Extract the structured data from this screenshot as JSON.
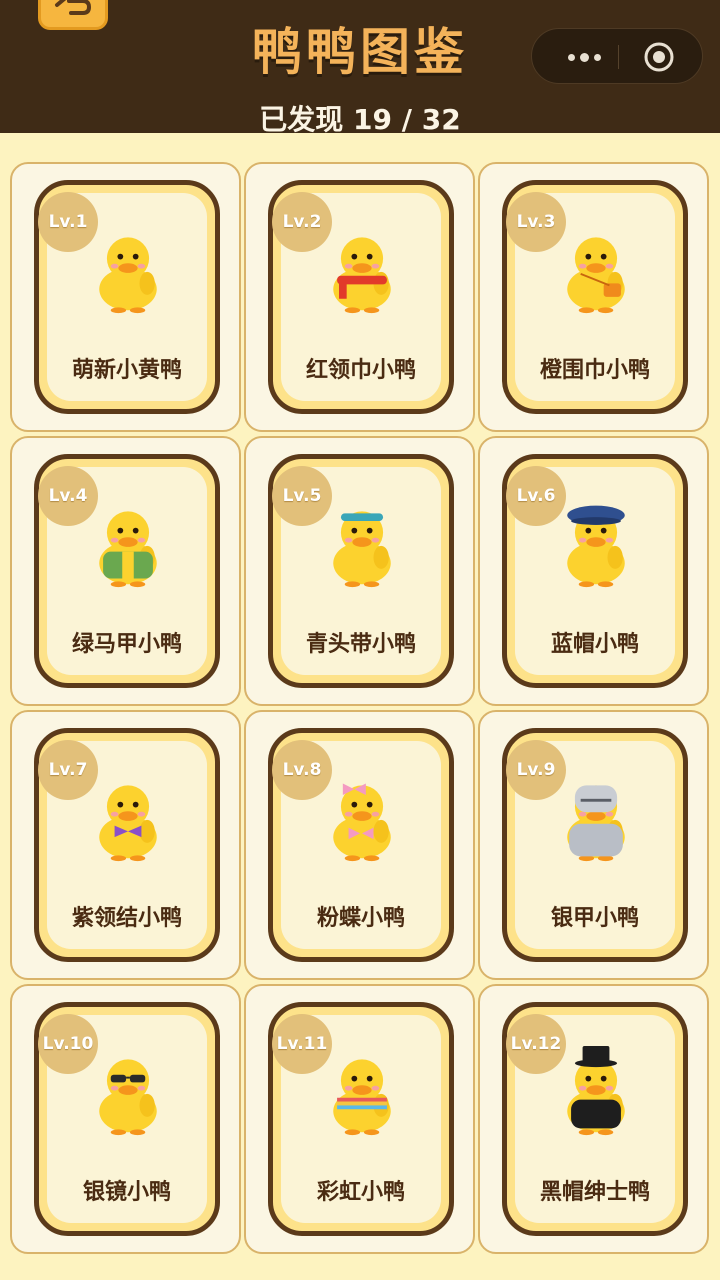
{
  "header": {
    "title": "鸭鸭图鉴",
    "progress": "已发现 19 / 32",
    "back_icon": "back-arrow-icon",
    "more_icon": "more-dots-icon",
    "close_icon": "close-target-icon"
  },
  "colors": {
    "header_bg": "#3f2b16",
    "title": "#f4b35a",
    "page_bg": "#fdf3c0",
    "card_border": "#d9b36a",
    "frame_border": "#5b3a1a"
  },
  "ducks": [
    {
      "level": "Lv.1",
      "name": "萌新小黄鸭",
      "accessory": "none"
    },
    {
      "level": "Lv.2",
      "name": "红领巾小鸭",
      "accessory": "red-scarf"
    },
    {
      "level": "Lv.3",
      "name": "橙围巾小鸭",
      "accessory": "orange-bag"
    },
    {
      "level": "Lv.4",
      "name": "绿马甲小鸭",
      "accessory": "green-vest"
    },
    {
      "level": "Lv.5",
      "name": "青头带小鸭",
      "accessory": "cyan-headband"
    },
    {
      "level": "Lv.6",
      "name": "蓝帽小鸭",
      "accessory": "blue-cap"
    },
    {
      "level": "Lv.7",
      "name": "紫领结小鸭",
      "accessory": "purple-bowtie"
    },
    {
      "level": "Lv.8",
      "name": "粉蝶小鸭",
      "accessory": "pink-bows"
    },
    {
      "level": "Lv.9",
      "name": "银甲小鸭",
      "accessory": "silver-armor"
    },
    {
      "level": "Lv.10",
      "name": "银镜小鸭",
      "accessory": "sunglasses"
    },
    {
      "level": "Lv.11",
      "name": "彩虹小鸭",
      "accessory": "rainbow-scarf"
    },
    {
      "level": "Lv.12",
      "name": "黑帽绅士鸭",
      "accessory": "top-hat"
    }
  ]
}
